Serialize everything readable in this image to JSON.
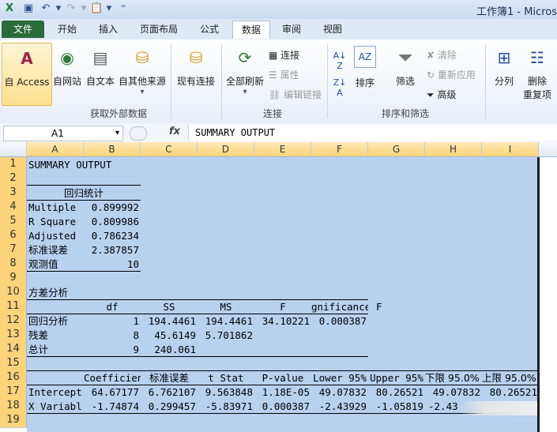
{
  "title_bar": {
    "title": "工作簿1 - Micros"
  },
  "tabs": [
    "文件",
    "开始",
    "插入",
    "页面布局",
    "公式",
    "数据",
    "审阅",
    "视图"
  ],
  "ribbon": {
    "external": {
      "buttons": [
        "自 Access",
        "自网站",
        "自文本",
        "自其他来源",
        "现有连接"
      ],
      "label": "获取外部数据"
    },
    "connections": {
      "refresh": "全部刷新",
      "connect": "连接",
      "properties": "属性",
      "edit_links": "编辑链接",
      "label": "连接"
    },
    "sort": {
      "sort": "排序",
      "filter": "筛选",
      "clear": "清除",
      "reapply": "重新应用",
      "advanced": "高级",
      "label": "排序和筛选"
    },
    "tools": {
      "split": "分列",
      "remove": "删除",
      "remove2": "重复项"
    }
  },
  "formula_bar": {
    "name_box": "A1",
    "fx": "fx",
    "formula": "SUMMARY OUTPUT"
  },
  "columns": [
    "A",
    "B",
    "C",
    "D",
    "E",
    "F",
    "G",
    "H",
    "I"
  ],
  "rows": [
    "1",
    "2",
    "3",
    "4",
    "5",
    "6",
    "7",
    "8",
    "9",
    "10",
    "11",
    "12",
    "13",
    "14",
    "15",
    "16",
    "17",
    "18",
    "19"
  ],
  "cells": {
    "r1": {
      "a": "SUMMARY OUTPUT"
    },
    "r3": {
      "a": "回归统计"
    },
    "r4": {
      "a": "Multiple",
      "b": "0.899992"
    },
    "r5": {
      "a": "R Square",
      "b": "0.809986"
    },
    "r6": {
      "a": "Adjusted",
      "b": "0.786234"
    },
    "r7": {
      "a": "标准误差",
      "b": "2.387857"
    },
    "r8": {
      "a": "观测值",
      "b": "10"
    },
    "r10": {
      "a": "方差分析"
    },
    "r11": {
      "b": "df",
      "c": "SS",
      "d": "MS",
      "e": "F",
      "f": "gnificance",
      "g": "F"
    },
    "r12": {
      "a": "回归分析",
      "b": "1",
      "c": "194.4461",
      "d": "194.4461",
      "e": "34.10221",
      "f": "0.000387"
    },
    "r13": {
      "a": "残差",
      "b": "8",
      "c": "45.6149",
      "d": "5.701862"
    },
    "r14": {
      "a": "总计",
      "b": "9",
      "c": "240.061"
    },
    "r16": {
      "b": "Coefficien",
      "c": "标准误差",
      "d": "t Stat",
      "e": "P-value",
      "f": "Lower 95%",
      "g": "Upper 95%",
      "h": "下限 95.0%",
      "i": "上限 95.0%"
    },
    "r17": {
      "a": "Intercept",
      "b": "64.67177",
      "c": "6.762107",
      "d": "9.563848",
      "e": "1.18E-05",
      "f": "49.07832",
      "g": "80.26521",
      "h": "49.07832",
      "i": "80.26521"
    },
    "r18": {
      "a": "X Variabl",
      "b": "-1.74874",
      "c": "0.299457",
      "d": "-5.83971",
      "e": "0.000387",
      "f": "-2.43929",
      "g": "-1.05819",
      "h": "-2.43"
    }
  }
}
